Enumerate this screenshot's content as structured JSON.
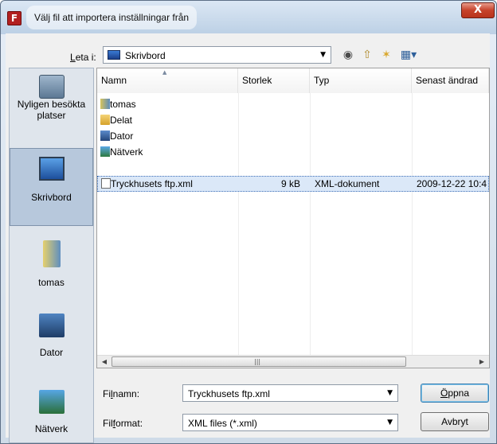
{
  "window": {
    "title": "Välj fil att importera inställningar från",
    "app_icon_letter": "F",
    "close_glyph": "X"
  },
  "lookin": {
    "label": "Leta i:",
    "value": "Skrivbord",
    "icons": [
      "back-icon",
      "up-folder-icon",
      "new-folder-icon",
      "view-menu-icon"
    ]
  },
  "places": [
    {
      "label": "Nyligen besökta platser",
      "icon": "recent-places-icon",
      "active": false
    },
    {
      "label": "Skrivbord",
      "icon": "desktop-icon",
      "active": true
    },
    {
      "label": "tomas",
      "icon": "user-folder-icon",
      "active": false
    },
    {
      "label": "Dator",
      "icon": "computer-icon",
      "active": false
    },
    {
      "label": "Nätverk",
      "icon": "network-icon",
      "active": false
    }
  ],
  "columns": {
    "name": "Namn",
    "size": "Storlek",
    "type": "Typ",
    "date": "Senast ändrad"
  },
  "files": [
    {
      "name": "tomas",
      "icon": "user-folder-icon",
      "size": "",
      "type": "",
      "date": ""
    },
    {
      "name": "Delat",
      "icon": "folder-icon",
      "size": "",
      "type": "",
      "date": ""
    },
    {
      "name": "Dator",
      "icon": "computer-icon",
      "size": "",
      "type": "",
      "date": ""
    },
    {
      "name": "Nätverk",
      "icon": "network-icon",
      "size": "",
      "type": "",
      "date": ""
    },
    {
      "name": "Tryckhusets ftp.xml",
      "icon": "xml-file-icon",
      "size": "9 kB",
      "type": "XML-dokument",
      "date": "2009-12-22 10:4",
      "selected": true
    }
  ],
  "filename": {
    "label": "Filnamn:",
    "value": "Tryckhusets ftp.xml"
  },
  "filetype": {
    "label": "Filformat:",
    "value": "XML files (*.xml)"
  },
  "buttons": {
    "open": "Öppna",
    "cancel": "Avbryt"
  }
}
